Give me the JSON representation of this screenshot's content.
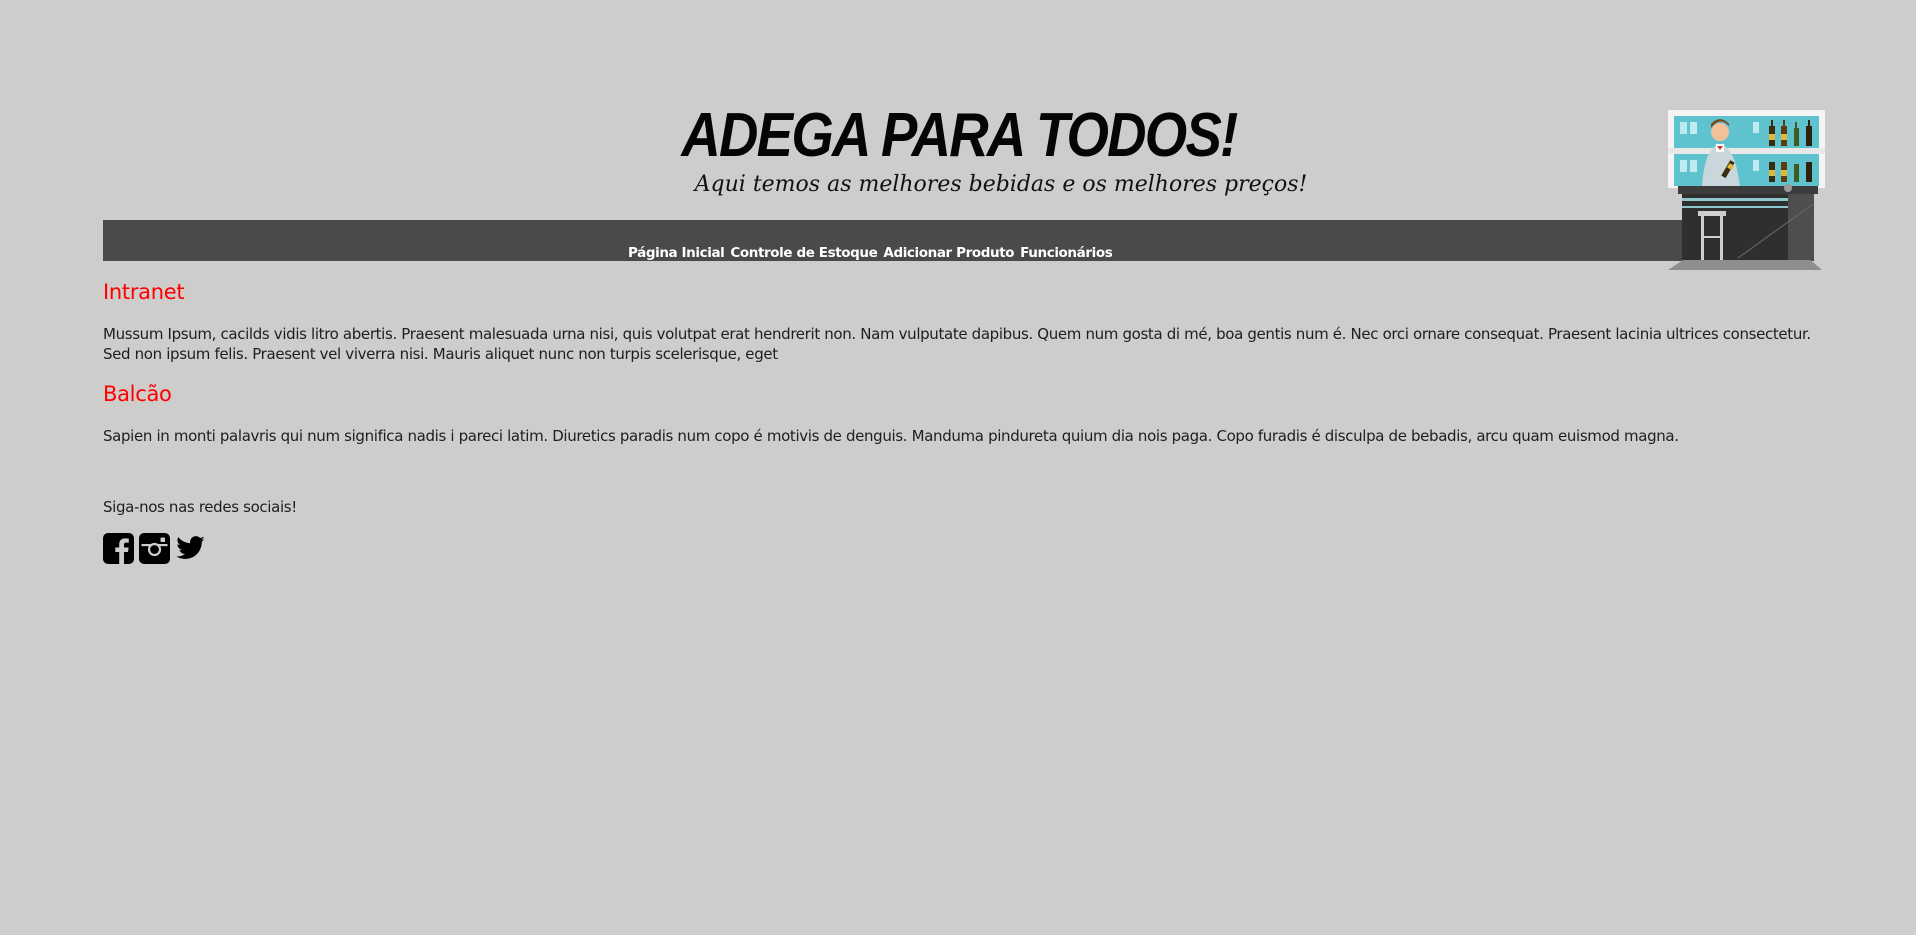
{
  "header": {
    "title": "ADEGA PARA TODOS!",
    "subtitle": "Aqui temos as melhores bebidas e os melhores preços!"
  },
  "nav": {
    "items": [
      {
        "label": "Página Inicial"
      },
      {
        "label": "Controle de Estoque"
      },
      {
        "label": "Adicionar Produto"
      },
      {
        "label": "Funcionários"
      }
    ]
  },
  "sections": [
    {
      "heading": "Intranet",
      "text": "Mussum Ipsum, cacilds vidis litro abertis. Praesent malesuada urna nisi, quis volutpat erat hendrerit non. Nam vulputate dapibus. Quem num gosta di mé, boa gentis num é. Nec orci ornare consequat. Praesent lacinia ultrices consectetur. Sed non ipsum felis. Praesent vel viverra nisi. Mauris aliquet nunc non turpis scelerisque, eget"
    },
    {
      "heading": "Balcão",
      "text": "Sapien in monti palavris qui num significa nadis i pareci latim. Diuretics paradis num copo é motivis de denguis. Manduma pindureta quium dia nois paga. Copo furadis é disculpa de bebadis, arcu quam euismod magna."
    }
  ],
  "footer": {
    "social_prompt": "Siga-nos nas redes sociais!",
    "icons": [
      "facebook-icon",
      "instagram-icon",
      "twitter-icon"
    ]
  },
  "colors": {
    "background": "#cecdcb",
    "navbar": "#4b4949",
    "heading_red": "#ff0000"
  }
}
